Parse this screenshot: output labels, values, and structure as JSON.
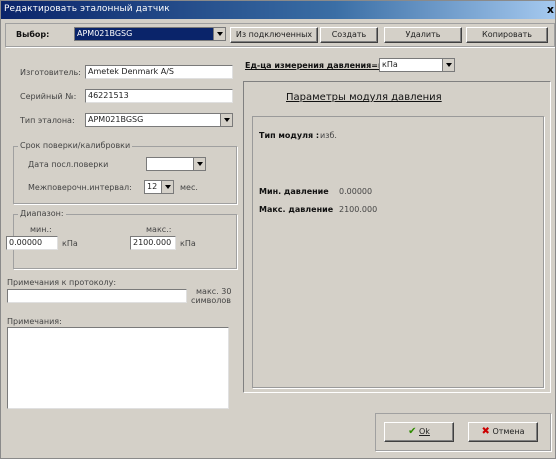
{
  "window": {
    "title": "Редактировать эталонный датчик",
    "close": "x"
  },
  "toolbar": {
    "select_label": "Выбор:",
    "select_value": "APM021BGSG",
    "buttons": [
      "Из подключенных",
      "Создать",
      "Удалить",
      "Копировать"
    ]
  },
  "form": {
    "manufacturer_label": "Изготовитель:",
    "manufacturer_value": "Ametek Denmark A/S",
    "serial_label": "Серийный №:",
    "serial_value": "46221513",
    "type_label": "Тип эталона:",
    "type_value": "APM021BGSG",
    "calib_group": "Срок поверки/калибровки",
    "last_date_label": "Дата посл.поверки",
    "last_date_value": "",
    "interval_label": "Межповерочн.интервал:",
    "interval_value": "12",
    "interval_unit": "мес.",
    "range_group": "Диапазон:",
    "min_label": "мин.:",
    "min_value": "0.00000",
    "min_unit": "кПа",
    "max_label": "макс.:",
    "max_value": "2100.000",
    "max_unit": "кПа",
    "protocol_notes_label": "Примечания к протоколу:",
    "protocol_notes_value": "",
    "max_chars_note_1": "макс. 30",
    "max_chars_note_2": "символов",
    "notes_label": "Примечания:",
    "notes_value": ""
  },
  "right": {
    "unit_label": "Ед-ца измерения давления=к",
    "unit_value": "кПа",
    "module_title": "Параметры модуля давления",
    "module_type_label": "Тип модуля :",
    "module_type_value": "изб.",
    "min_pressure_label": "Мин. давление",
    "min_pressure_value": "0.00000",
    "max_pressure_label": "Макс. давление",
    "max_pressure_value": "2100.000"
  },
  "footer": {
    "ok_label": "Ok",
    "ok_mnemonic": "O",
    "cancel_label": "Отмена",
    "cancel_mnemonic": "О"
  },
  "colors": {
    "title_bar": "#0a246a",
    "face": "#d4d0c8",
    "ok_check": "#2e8b00",
    "cancel_x": "#cc0000"
  }
}
